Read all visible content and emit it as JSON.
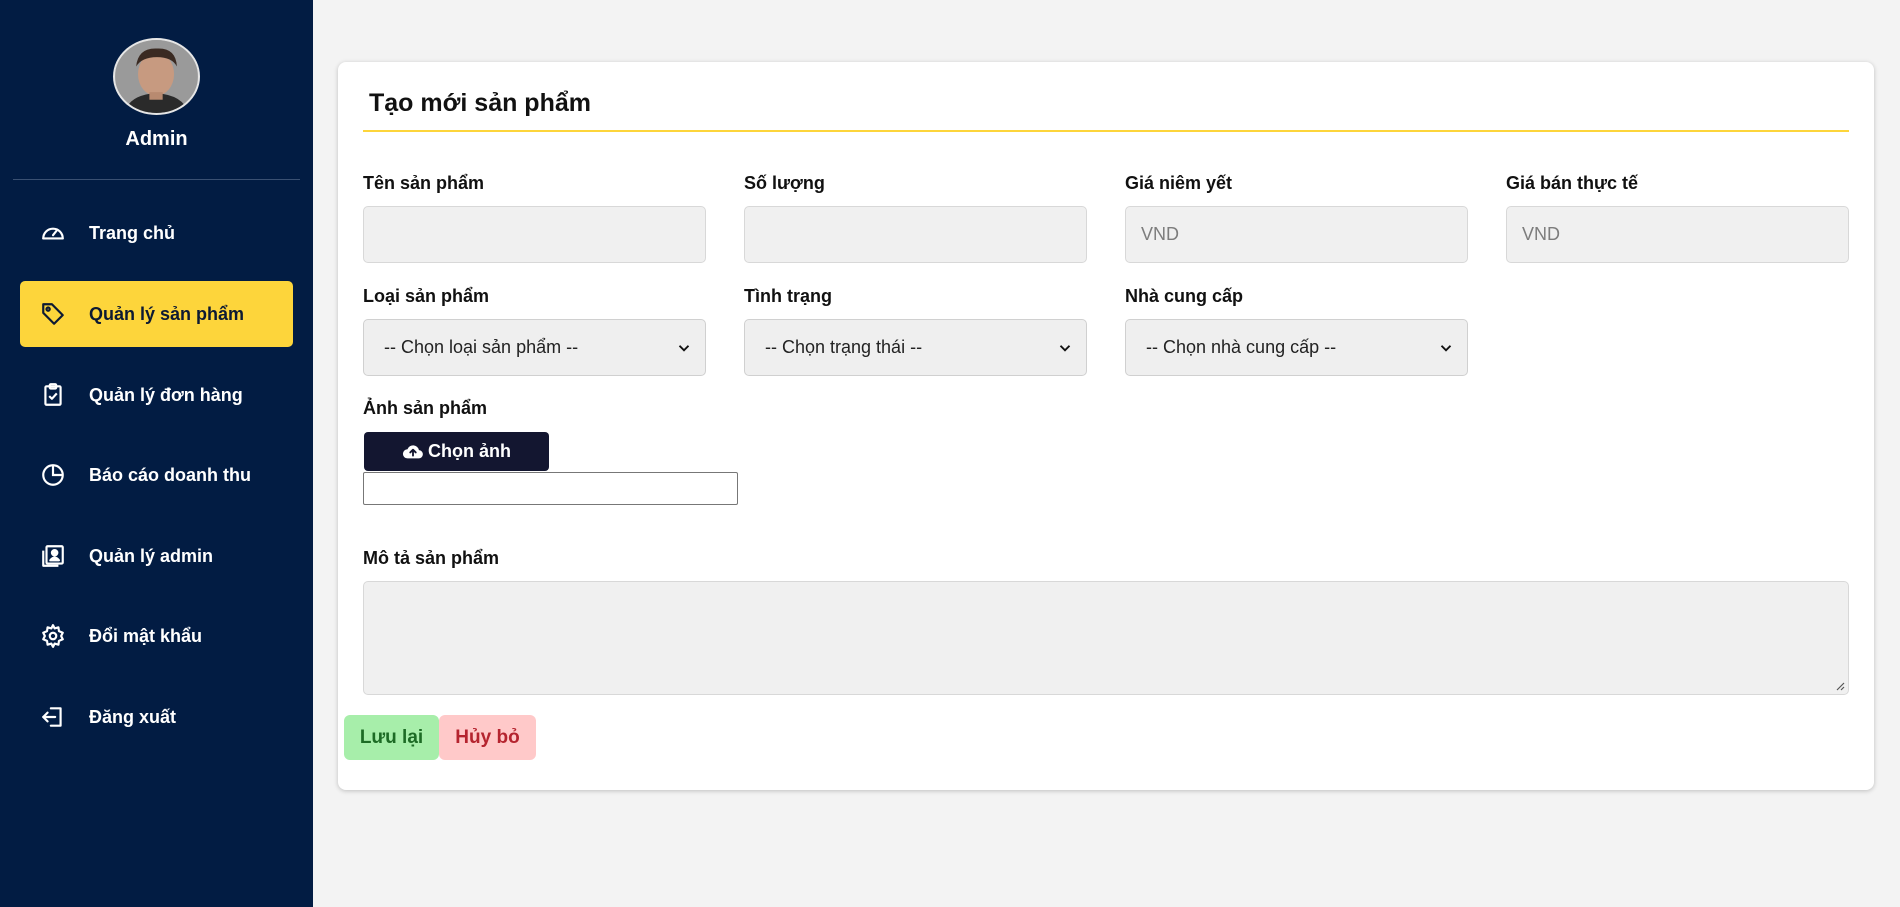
{
  "sidebar": {
    "user_name": "Admin",
    "items": [
      {
        "label": "Trang chủ",
        "icon": "dashboard-gauge-icon"
      },
      {
        "label": "Quản lý sản phẩm",
        "icon": "tag-icon",
        "active": true
      },
      {
        "label": "Quản lý đơn hàng",
        "icon": "clipboard-check-icon"
      },
      {
        "label": "Báo cáo doanh thu",
        "icon": "pie-chart-icon"
      },
      {
        "label": "Quản lý admin",
        "icon": "user-list-icon"
      },
      {
        "label": "Đổi mật khẩu",
        "icon": "gear-icon"
      },
      {
        "label": "Đăng xuất",
        "icon": "logout-icon"
      }
    ],
    "colors": {
      "background": "#021c43",
      "active": "#fdd53b"
    }
  },
  "form": {
    "title": "Tạo mới sản phẩm",
    "fields": {
      "name": {
        "label": "Tên sản phẩm",
        "value": "",
        "placeholder": ""
      },
      "quantity": {
        "label": "Số lượng",
        "value": "",
        "placeholder": ""
      },
      "list_price": {
        "label": "Giá niêm yết",
        "value": "",
        "placeholder": "VND"
      },
      "sale_price": {
        "label": "Giá bán thực tế",
        "value": "",
        "placeholder": "VND"
      },
      "category": {
        "label": "Loại sản phẩm",
        "selected": "-- Chọn loại sản phẩm --"
      },
      "status": {
        "label": "Tình trạng",
        "selected": "-- Chọn trạng thái --"
      },
      "supplier": {
        "label": "Nhà cung cấp",
        "selected": "-- Chọn nhà cung cấp --"
      },
      "image": {
        "label": "Ảnh sản phẩm",
        "button_label": "Chọn ảnh"
      },
      "description": {
        "label": "Mô tả sản phẩm",
        "value": ""
      }
    },
    "actions": {
      "save_label": "Lưu lại",
      "cancel_label": "Hủy bỏ"
    }
  }
}
